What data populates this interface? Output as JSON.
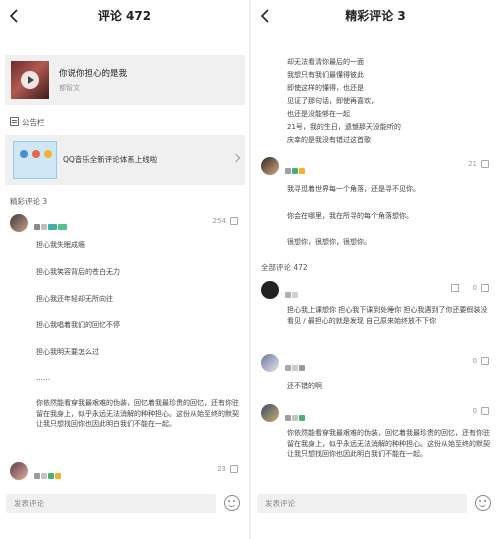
{
  "left": {
    "title": "评论 472",
    "song": {
      "title": "你说你担心的是我",
      "artist": "都智文"
    },
    "notice": {
      "label": "公告栏",
      "text": "QQ音乐全新评论体系上线啦"
    },
    "featured_label": "精彩评论 3",
    "comment1": {
      "likes": "254",
      "lines": [
        "担心我失眠成瘾",
        "担心我笑容背后的苍白无力",
        "担心我还年轻却无所向往",
        "担心我唱着我们的回忆不停",
        "担心我明天要怎么过",
        "……"
      ],
      "para": "你依然能看穿我最艰难的伪装，回忆着我最珍贵的回忆，还有你驻留在我身上，似乎永远无法消解的种种担心。这份从始至终的默契让我只想找回你也因此明白我们不能在一起。"
    },
    "comment2": {
      "likes": "23"
    },
    "input_placeholder": "发表评论"
  },
  "right": {
    "title": "精彩评论 3",
    "top_lines": [
      "却无法看清你最后的一面",
      "我想只有我们最懂得彼此",
      "即使这样的懂得，也还是",
      "见证了那句话，即使再喜欢，",
      "也还是没能够在一起",
      "21号，我的生日，遗憾那天没能听的",
      "庆幸的是我没有错过这首歌"
    ],
    "c1": {
      "likes": "21",
      "lines": [
        "我寻觅着世界每一个角落，还是寻不见你。",
        "你会在哪里，我在所寻的每个角落想你。",
        "很想你，很想你，很想你。"
      ]
    },
    "all_label": "全部评论 472",
    "c2": {
      "likes": "0",
      "text": "担心我上课想你 担心我下课到处睡你 担心我遇到了你还要假装没看见 / 最担心的就是发现 自己原来始终放不下你"
    },
    "c3": {
      "likes": "0",
      "text": "还不错的啊"
    },
    "c4": {
      "likes": "0",
      "text": "你依然能看穿我最艰难的伪装，回忆着我最珍贵的回忆，还有你驻留在我身上，似乎永远无法消解的种种担心。这份从始至终的默契让我只想找回你也因此明白我们不能在一起。"
    },
    "input_placeholder": "发表评论"
  }
}
